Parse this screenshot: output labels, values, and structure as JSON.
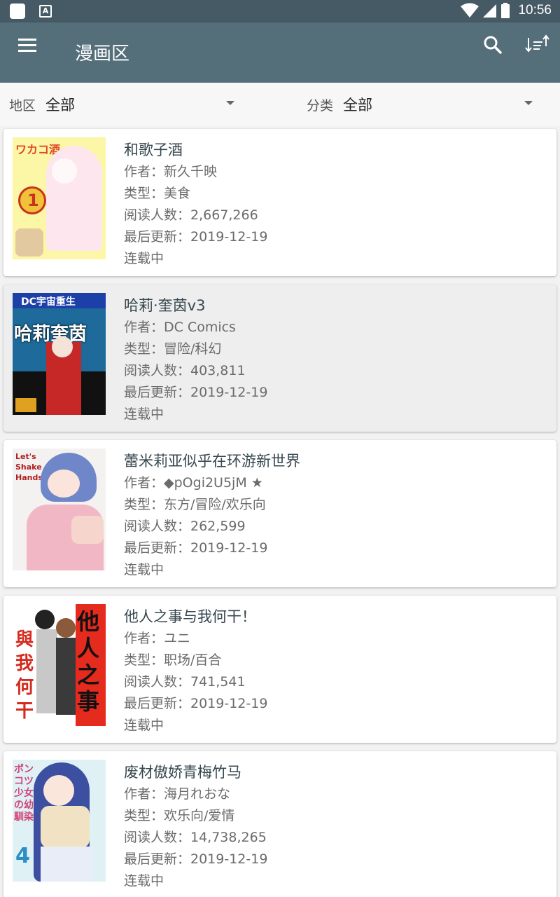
{
  "status": {
    "time": "10:56"
  },
  "app_bar": {
    "title": "漫画区"
  },
  "filters": {
    "region": {
      "label": "地区",
      "value": "全部"
    },
    "category": {
      "label": "分类",
      "value": "全部"
    }
  },
  "cover_texts": {
    "c0_title": "ワカコ酒",
    "c0_num": "1",
    "c1_banner": "DC宇宙重生",
    "c1_title": "哈莉奎茵",
    "c2_title": "Let's Shake Hands!",
    "c3_right": "他人之事",
    "c3_left": "與我何干",
    "c4_title": "ポンコツ少女の幼馴染",
    "c4_num": "4"
  },
  "comics": [
    {
      "title": "和歌子酒",
      "author": "作者：新久千映",
      "genre": "类型：美食",
      "readers": "阅读人数：2,667,266",
      "updated": "最后更新：2019-12-19",
      "status": "连载中"
    },
    {
      "title": "哈莉·奎茵v3",
      "author": "作者：DC Comics",
      "genre": "类型：冒险/科幻",
      "readers": "阅读人数：403,811",
      "updated": "最后更新：2019-12-19",
      "status": "连载中"
    },
    {
      "title": "蕾米莉亚似乎在环游新世界",
      "author": "作者：◆pOgi2U5jM ★",
      "genre": "类型：东方/冒险/欢乐向",
      "readers": "阅读人数：262,599",
      "updated": "最后更新：2019-12-19",
      "status": "连载中"
    },
    {
      "title": "他人之事与我何干！",
      "author": "作者：ユニ",
      "genre": "类型：职场/百合",
      "readers": "阅读人数：741,541",
      "updated": "最后更新：2019-12-19",
      "status": "连载中"
    },
    {
      "title": "废材傲娇青梅竹马",
      "author": "作者：海月れおな",
      "genre": "类型：欢乐向/爱情",
      "readers": "阅读人数：14,738,265",
      "updated": "最后更新：2019-12-19",
      "status": "连载中"
    }
  ]
}
